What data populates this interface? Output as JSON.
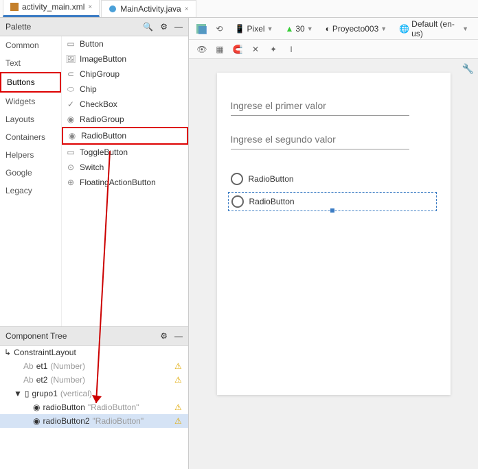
{
  "tabs": [
    {
      "label": "activity_main.xml",
      "icon": "xml",
      "active": true
    },
    {
      "label": "MainActivity.java",
      "icon": "java",
      "active": false
    }
  ],
  "palette": {
    "title": "Palette",
    "categories": [
      "Common",
      "Text",
      "Buttons",
      "Widgets",
      "Layouts",
      "Containers",
      "Helpers",
      "Google",
      "Legacy"
    ],
    "highlight_category": "Buttons",
    "items": [
      "Button",
      "ImageButton",
      "ChipGroup",
      "Chip",
      "CheckBox",
      "RadioGroup",
      "RadioButton",
      "ToggleButton",
      "Switch",
      "FloatingActionButton"
    ],
    "highlight_item": "RadioButton"
  },
  "tree": {
    "title": "Component Tree",
    "root": "ConstraintLayout",
    "rows": [
      {
        "id": "et1",
        "hint": "(Number)",
        "warn": true
      },
      {
        "id": "et2",
        "hint": "(Number)",
        "warn": true
      },
      {
        "id": "grupo1",
        "hint": "(vertical)",
        "children": [
          {
            "id": "radioButton",
            "text": "\"RadioButton\"",
            "warn": true
          },
          {
            "id": "radioButton2",
            "text": "\"RadioButton\"",
            "warn": true,
            "selected": true
          }
        ]
      }
    ]
  },
  "toolbar": {
    "device": "Pixel",
    "api": "30",
    "project": "Proyecto003",
    "locale": "Default (en-us)"
  },
  "design": {
    "hint1": "Ingrese el primer valor",
    "hint2": "Ingrese el segundo valor",
    "radio1": "RadioButton",
    "radio2": "RadioButton"
  }
}
